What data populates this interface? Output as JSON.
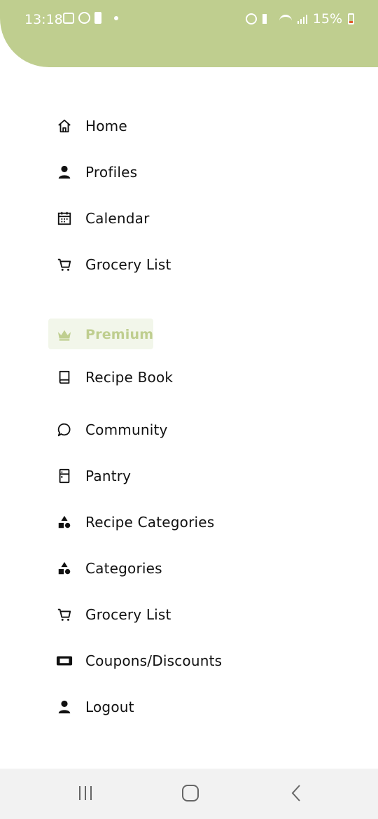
{
  "status_bar": {
    "time": "13:18",
    "battery_percent": "15%"
  },
  "menu": {
    "items": [
      {
        "label": "Home",
        "icon": "home-icon"
      },
      {
        "label": "Profiles",
        "icon": "person-icon"
      },
      {
        "label": "Calendar",
        "icon": "calendar-icon"
      },
      {
        "label": "Grocery List",
        "icon": "cart-icon"
      }
    ],
    "premium_label": "Premium",
    "premium_items": [
      {
        "label": "Recipe Book",
        "icon": "book-icon"
      },
      {
        "label": "Community",
        "icon": "chat-bubble-icon"
      },
      {
        "label": "Pantry",
        "icon": "fridge-icon"
      },
      {
        "label": "Recipe Categories",
        "icon": "shapes-icon"
      },
      {
        "label": "Categories",
        "icon": "shapes-icon"
      },
      {
        "label": "Grocery List",
        "icon": "cart-icon"
      },
      {
        "label": "Coupons/Discounts",
        "icon": "ticket-icon"
      },
      {
        "label": "Logout",
        "icon": "person-icon"
      }
    ]
  },
  "colors": {
    "accent": "#bfce8f",
    "premium_bg": "#f2f6ea",
    "text": "#111111",
    "nav_bg": "#f2f2f2"
  }
}
